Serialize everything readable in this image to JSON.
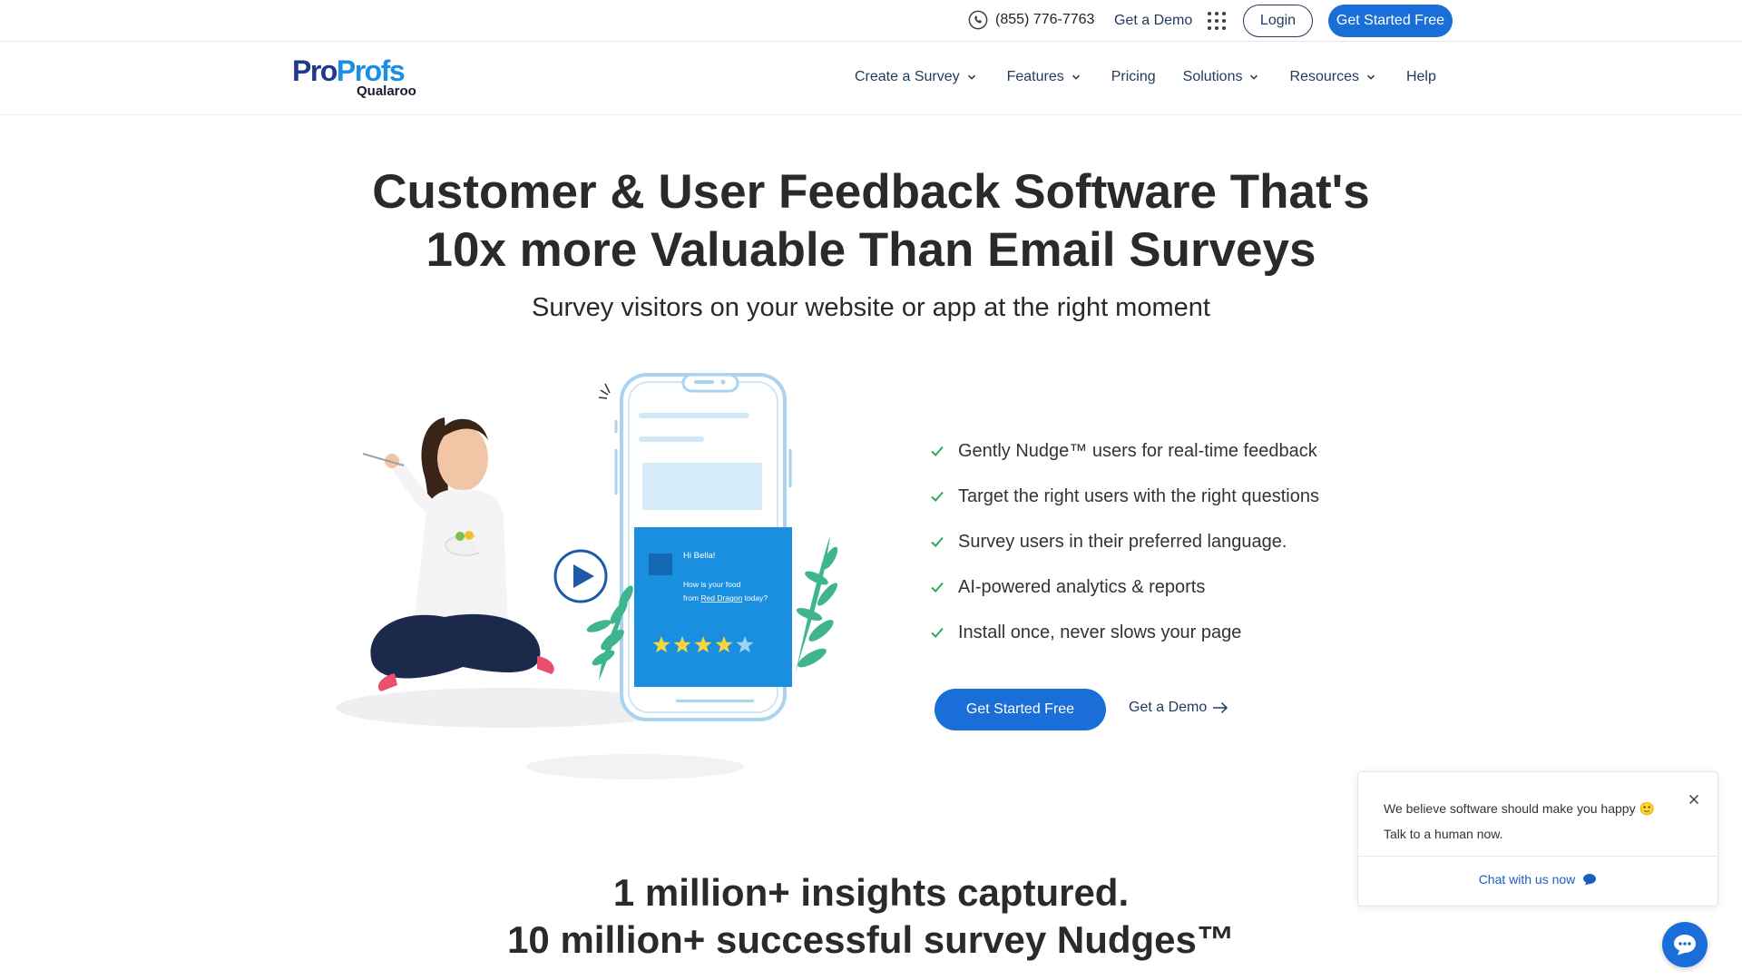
{
  "topbar": {
    "phone": "(855) 776-7763",
    "demo_label": "Get a Demo",
    "login_label": "Login",
    "cta_label": "Get Started Free"
  },
  "logo": {
    "part1": "Pro",
    "part2": "Profs",
    "sub": "Qualaroo"
  },
  "nav": {
    "items": [
      {
        "label": "Create a Survey",
        "dropdown": true
      },
      {
        "label": "Features",
        "dropdown": true
      },
      {
        "label": "Pricing",
        "dropdown": false
      },
      {
        "label": "Solutions",
        "dropdown": true
      },
      {
        "label": "Resources",
        "dropdown": true
      },
      {
        "label": "Help",
        "dropdown": false
      }
    ]
  },
  "hero": {
    "title_line1": "Customer & User Feedback Software That's",
    "title_line2": "10x more Valuable Than Email Surveys",
    "subtitle": "Survey visitors on your website or app at the right moment",
    "cta_label": "Get Started Free",
    "demo_label": "Get a Demo"
  },
  "survey_card": {
    "greeting": "Hi Bella!",
    "question_line1": "How is your food",
    "question_line2_pre": "from ",
    "question_link": "Red Dragon",
    "question_line2_post": " today?",
    "rating": 4,
    "max_rating": 5
  },
  "features": [
    "Gently Nudge™ users for real-time feedback",
    "Target the right users with the right questions",
    "Survey users in their preferred language.",
    "AI-powered analytics & reports",
    "Install once, never slows your page"
  ],
  "stats": {
    "line1": "1 million+ insights captured.",
    "line2": "10 million+ successful survey Nudges™"
  },
  "chat": {
    "message_line1": "We believe software should make you happy 🙂",
    "message_line2": "Talk to a human now.",
    "link_label": "Chat with us now"
  },
  "colors": {
    "primary": "#1a6ed8",
    "navy": "#1e3a5c",
    "check": "#2eaa5c",
    "card": "#1a8fe0",
    "star": "#f5d63d"
  }
}
